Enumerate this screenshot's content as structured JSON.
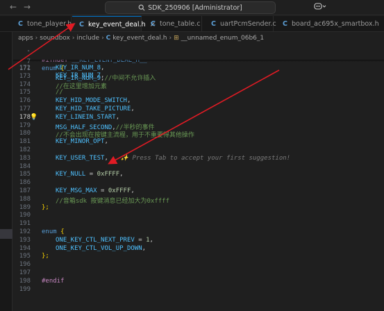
{
  "titlebar": {
    "back": "←",
    "forward": "→",
    "search_text": "SDK_250906 [Administrator]",
    "copilot_icon": "copilot-icon"
  },
  "tabs": [
    {
      "label": "tone_player.h",
      "active": false
    },
    {
      "label": "key_event_deal.h",
      "active": true,
      "close": "×"
    },
    {
      "label": "tone_table.c",
      "active": false
    },
    {
      "label": "uartPcmSender.c",
      "active": false
    },
    {
      "label": "board_ac695x_smartbox.h",
      "active": false
    }
  ],
  "breadcrumb": {
    "p1": "apps",
    "p2": "soundbox",
    "p3": "include",
    "p4": "key_event_deal.h",
    "p5": "__unnamed_enum_06b6_1"
  },
  "editor": {
    "sticky": [
      {
        "n": "1",
        "directive": "#ifndef",
        "name": "__KEY_EVENT_DEAL_H__"
      },
      {
        "n": "7",
        "kw": "enum",
        "brace": "{"
      }
    ],
    "lines": [
      {
        "n": "172",
        "id": "KEY_IR_NUM_8",
        "tail": ",",
        "comment": ""
      },
      {
        "n": "173",
        "id": "KEY_IR_NUM_9",
        "tail": ",",
        "comment": "//中间不允许插入"
      },
      {
        "n": "174",
        "id": "",
        "tail": "",
        "comment": "//在这里增加元素"
      },
      {
        "n": "175",
        "id": "",
        "tail": "",
        "comment": "//"
      },
      {
        "n": "176",
        "id": "KEY_HID_MODE_SWITCH",
        "tail": ",",
        "comment": ""
      },
      {
        "n": "177",
        "id": "KEY_HID_TAKE_PICTURE",
        "tail": ",",
        "comment": ""
      },
      {
        "n": "178",
        "id": "KEY_LINEIN_START",
        "tail": ",",
        "comment": "",
        "current": true
      },
      {
        "n": "179",
        "id": "MSG_HALF_SECOND",
        "tail": ",",
        "comment": "//半秒的事件"
      },
      {
        "n": "180",
        "id": "",
        "tail": "",
        "comment": "//不会出现在按键主流程，用于不重要得其他操作"
      },
      {
        "n": "181",
        "id": "KEY_MINOR_OPT",
        "tail": ",",
        "comment": ""
      },
      {
        "n": "182",
        "id": "",
        "tail": "",
        "comment": ""
      },
      {
        "n": "183",
        "id": "KEY_USER_TEST",
        "tail": ",",
        "comment": "",
        "ghost": "✨ Press Tab to accept your first suggestion!"
      },
      {
        "n": "184",
        "id": "",
        "tail": "",
        "comment": ""
      },
      {
        "n": "185",
        "id": "KEY_NULL",
        "tail": " = ",
        "num": "0xFFFF",
        "end": ",",
        "comment": ""
      },
      {
        "n": "186",
        "id": "",
        "tail": "",
        "comment": ""
      },
      {
        "n": "187",
        "id": "KEY_MSG_MAX",
        "tail": " = ",
        "num": "0xFFFF",
        "end": ",",
        "comment": ""
      },
      {
        "n": "188",
        "id": "",
        "tail": "",
        "comment": "//音箱sdk 按键消息已经加大为0xffff"
      },
      {
        "n": "189",
        "brace_close": "};"
      },
      {
        "n": "190"
      },
      {
        "n": "191"
      },
      {
        "n": "192",
        "kw": "enum",
        "brace": "{"
      },
      {
        "n": "193",
        "id": "ONE_KEY_CTL_NEXT_PREV",
        "tail": " = ",
        "num": "1",
        "end": ",",
        "comment": ""
      },
      {
        "n": "194",
        "id": "ONE_KEY_CTL_VOL_UP_DOWN",
        "tail": ",",
        "comment": ""
      },
      {
        "n": "195",
        "brace_close": "};"
      },
      {
        "n": "196"
      },
      {
        "n": "197"
      },
      {
        "n": "198",
        "directive": "#endif"
      },
      {
        "n": "199"
      }
    ],
    "partial_line": {
      "n": "171",
      "id": "KEY_IR_NUM_7",
      "tail": ","
    }
  },
  "colors": {
    "background": "#1f1f1f",
    "annotation_arrow": "#e01b24",
    "accent": "#0078d4"
  }
}
